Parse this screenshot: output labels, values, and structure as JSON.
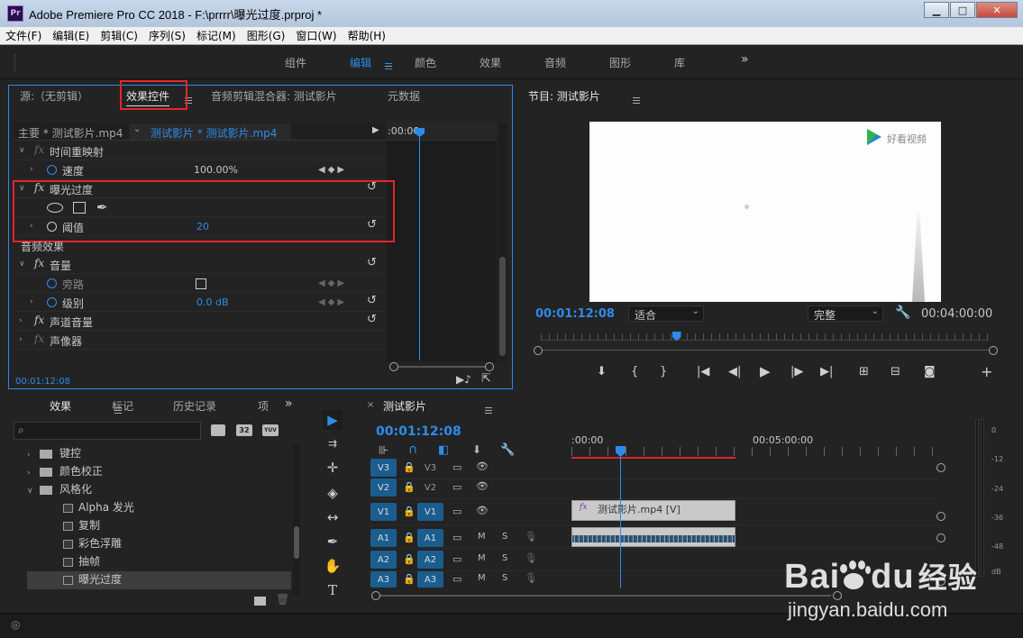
{
  "window": {
    "title": "Adobe Premiere Pro CC 2018 - F:\\prrrr\\曝光过度.prproj *",
    "logo": "Pr",
    "controls": [
      "minimize-icon",
      "maximize-icon",
      "close-icon"
    ]
  },
  "menu": [
    "文件(F)",
    "编辑(E)",
    "剪辑(C)",
    "序列(S)",
    "标记(M)",
    "图形(G)",
    "窗口(W)",
    "帮助(H)"
  ],
  "workspaces": {
    "items": [
      "组件",
      "编辑",
      "颜色",
      "效果",
      "音频",
      "图形",
      "库"
    ],
    "active": "编辑",
    "more": "»"
  },
  "effect_controls": {
    "tabs": [
      "源:（无剪辑）",
      "效果控件",
      "音频剪辑混合器: 测试影片",
      "元数据"
    ],
    "master": "主要 * 测试影片.mp4",
    "clip": "测试影片 * 测试影片.mp4",
    "timecode_ruler": ":00:00",
    "rows": {
      "time_remap": "时间重映射",
      "speed_label": "速度",
      "speed_value": "100.00%",
      "effect_name": "曝光过度",
      "threshold_label": "阈值",
      "threshold_value": "20",
      "audio_effects": "音频效果",
      "volume": "音量",
      "bypass": "旁路",
      "level_label": "级别",
      "level_value": "0.0 dB",
      "channel_volume": "声道音量",
      "panner": "声像器"
    },
    "timecode": "00:01:12:08"
  },
  "program": {
    "title": "节目: 测试影片",
    "watermark": "好看视频",
    "timecode": "00:01:12:08",
    "fit": "适合",
    "quality": "完整",
    "duration": "00:04:00:00",
    "playhead_fraction": 0.3
  },
  "effects_panel": {
    "tabs": [
      "效果",
      "标记",
      "历史记录",
      "项"
    ],
    "more": "»",
    "search_placeholder": "",
    "badges": [
      "32",
      "YUV"
    ],
    "items": [
      {
        "label": "键控",
        "type": "folder",
        "indent": 1
      },
      {
        "label": "颜色校正",
        "type": "folder",
        "indent": 1
      },
      {
        "label": "风格化",
        "type": "folder",
        "indent": 1,
        "open": true
      },
      {
        "label": "Alpha 发光",
        "type": "effect",
        "indent": 2
      },
      {
        "label": "复制",
        "type": "effect",
        "indent": 2
      },
      {
        "label": "彩色浮雕",
        "type": "effect",
        "indent": 2
      },
      {
        "label": "抽帧",
        "type": "effect",
        "indent": 2
      },
      {
        "label": "曝光过度",
        "type": "effect",
        "indent": 2,
        "selected": true
      }
    ]
  },
  "timeline": {
    "title": "测试影片",
    "timecode": "00:01:12:08",
    "ruler": [
      ":00:00",
      "00:05:00:00"
    ],
    "tracks": [
      {
        "src": "V3",
        "name": "V3"
      },
      {
        "src": "V2",
        "name": "V2"
      },
      {
        "src": "V1",
        "name": "V1"
      },
      {
        "src": "A1",
        "name": "A1"
      },
      {
        "src": "A2",
        "name": "A2"
      },
      {
        "src": "A3",
        "name": "A3"
      }
    ],
    "audio_m": "M",
    "audio_s": "S",
    "clip_label": "测试影片.mp4 [V]",
    "clip_fx": "fx"
  },
  "meter": {
    "labels": [
      "0",
      "-12",
      "-24",
      "-36",
      "-48",
      "dB"
    ]
  },
  "brand": {
    "baidu": "Bai",
    "du": "du",
    "jingyan": "经验",
    "url": "jingyan.baidu.com"
  }
}
